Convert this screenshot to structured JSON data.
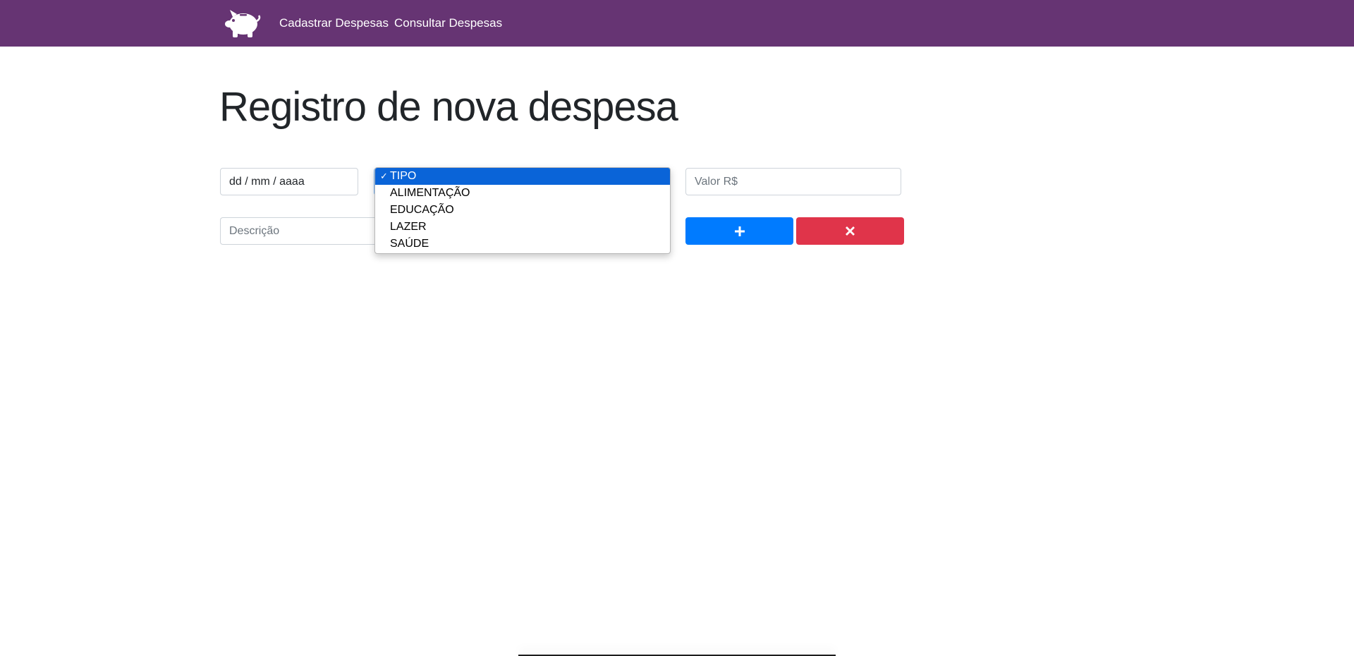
{
  "nav": {
    "logo_icon": "piggy-bank-icon",
    "links": [
      "Cadastrar Despesas",
      "Consultar Despesas"
    ],
    "background": "#663473"
  },
  "main": {
    "title": "Registro de nova despesa"
  },
  "form": {
    "date_placeholder": "dd / mm / aaaa",
    "tipo": {
      "selected": "TIPO",
      "options": [
        "TIPO",
        "ALIMENTAÇÃO",
        "EDUCAÇÃO",
        "LAZER",
        "SAÚDE"
      ]
    },
    "valor_placeholder": "Valor R$",
    "descricao_placeholder": "Descrição",
    "add_button_icon": "plus-icon",
    "clear_button_icon": "times-icon",
    "add_color": "#007bff",
    "clear_color": "#e0344a"
  }
}
